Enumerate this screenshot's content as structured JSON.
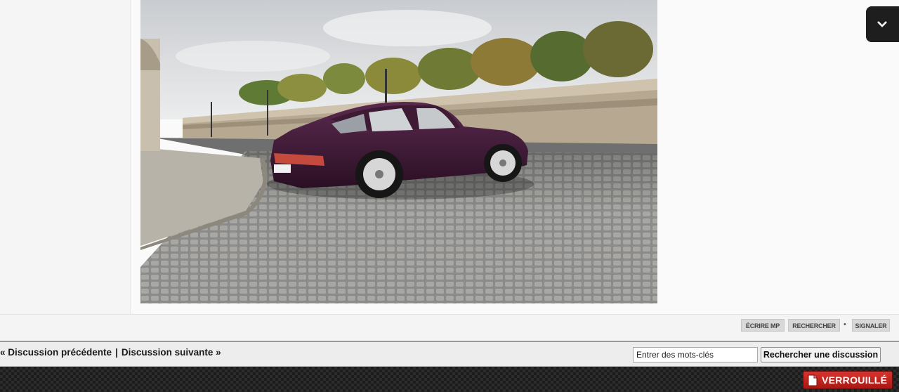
{
  "post": {
    "photo_alt": "",
    "actions": [
      {
        "label": "ÉCRIRE MP"
      },
      {
        "label": "RECHERCHER"
      },
      {
        "label": "SIGNALER"
      }
    ],
    "separator": "•"
  },
  "navigation": {
    "prev_label": "« Discussion précédente",
    "divider": "|",
    "next_label": "Discussion suivante »"
  },
  "search": {
    "placeholder": "Entrer des mots-clés",
    "button_label": "Rechercher une discussion"
  },
  "status": {
    "locked_label": "VERROUILLÉ",
    "locked_color": "#c0221d"
  },
  "collapse_tab": {
    "icon": "chevron-down-icon"
  }
}
